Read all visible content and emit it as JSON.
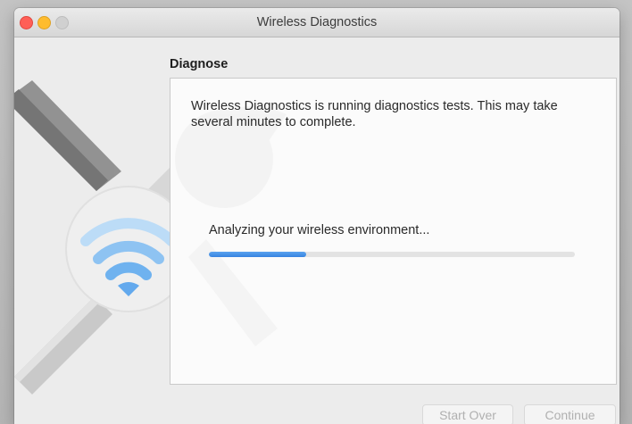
{
  "window": {
    "title": "Wireless Diagnostics",
    "traffic_lights": [
      "close",
      "minimize",
      "zoom"
    ]
  },
  "section": {
    "title": "Diagnose"
  },
  "panel": {
    "description": "Wireless Diagnostics is running diagnostics tests. This may take several minutes to complete.",
    "status": "Analyzing your wireless environment...",
    "progress": 0.265
  },
  "buttons": {
    "start_over": "Start Over",
    "continue": "Continue"
  },
  "icons": {
    "app": "wireless-diagnostics-wrench-wifi-icon"
  },
  "colors": {
    "accent": "#3884e0",
    "close": "#ff5f57",
    "minimize": "#febc2e"
  }
}
